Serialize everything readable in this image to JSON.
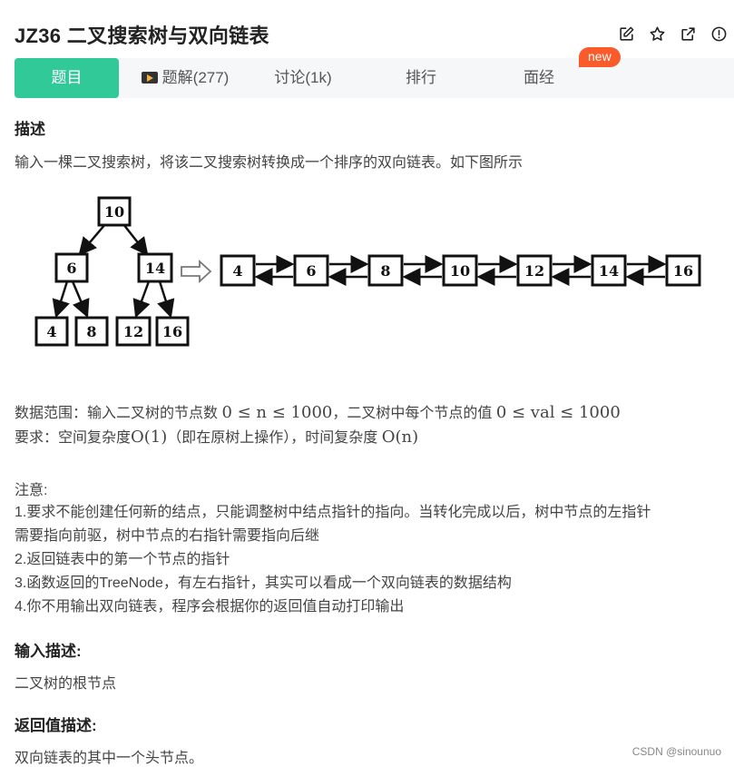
{
  "problem": {
    "title": "JZ36  二叉搜索树与双向链表"
  },
  "header_icons": [
    "edit-icon",
    "star-icon",
    "share-icon",
    "report-icon"
  ],
  "tabs": [
    {
      "label": "题目",
      "active": true
    },
    {
      "label": "题解(277)",
      "icon": "video-icon"
    },
    {
      "label": "讨论(1k)"
    },
    {
      "label": "排行"
    },
    {
      "label": "面经"
    }
  ],
  "new_badge": "new",
  "description": {
    "heading": "描述",
    "intro": "输入一棵二叉搜索树，将该二叉搜索树转换成一个排序的双向链表。如下图所示",
    "tree": {
      "root": "10",
      "level2": [
        "6",
        "14"
      ],
      "leaves": [
        "4",
        "8",
        "12",
        "16"
      ]
    },
    "list": [
      "4",
      "6",
      "8",
      "10",
      "12",
      "14",
      "16"
    ],
    "range_prefix": "数据范围：输入二叉树的节点数 ",
    "range_math1": "0 ≤ n ≤ 1000",
    "range_mid": "，二叉树中每个节点的值 ",
    "range_math2": "0 ≤ val ≤ 1000",
    "req_prefix": "要求：空间复杂度",
    "req_math1": "O(1)",
    "req_mid": "（即在原树上操作），时间复杂度 ",
    "req_math2": "O(n)",
    "note_title": "注意:",
    "notes": [
      "1.要求不能创建任何新的结点，只能调整树中结点指针的指向。当转化完成以后，树中节点的左指针",
      "需要指向前驱，树中节点的右指针需要指向后继",
      "2.返回链表中的第一个节点的指针",
      "3.函数返回的TreeNode，有左右指针，其实可以看成一个双向链表的数据结构",
      "4.你不用输出双向链表，程序会根据你的返回值自动打印输出"
    ]
  },
  "input_desc": {
    "heading": "输入描述:",
    "text": "二叉树的根节点"
  },
  "output_desc": {
    "heading": "返回值描述:",
    "text": "双向链表的其中一个头节点。"
  },
  "watermark": "CSDN @sinounuo"
}
